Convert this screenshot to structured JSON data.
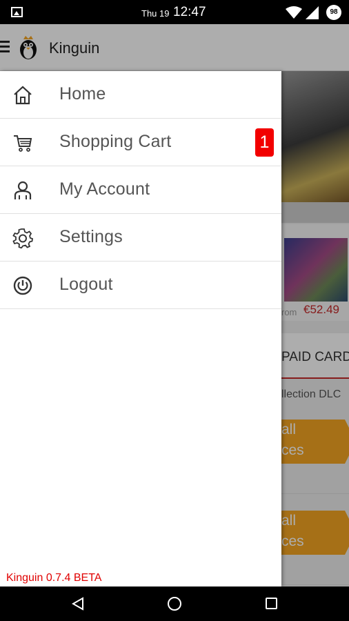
{
  "status_bar": {
    "day": "Thu 19",
    "time": "12:47",
    "battery": "98"
  },
  "app_bar": {
    "title": "Kinguin"
  },
  "background": {
    "from_label": "rom",
    "price": "€52.49",
    "tab_label": "PAID CARDS",
    "dlc_label": "llection DLC",
    "button1_line1": "all",
    "button1_line2": "ces",
    "button2_line1": "all",
    "button2_line2": "ces"
  },
  "drawer": {
    "items": [
      {
        "label": "Home",
        "icon": "home-icon"
      },
      {
        "label": "Shopping Cart",
        "icon": "cart-icon",
        "badge": "1"
      },
      {
        "label": "My Account",
        "icon": "account-icon"
      },
      {
        "label": "Settings",
        "icon": "gear-icon"
      },
      {
        "label": "Logout",
        "icon": "power-icon"
      }
    ],
    "version": "Kinguin 0.7.4 BETA"
  },
  "colors": {
    "badge": "#f20000",
    "version_text": "#e00000",
    "price": "#c62828",
    "accent_button": "#f5a623"
  }
}
